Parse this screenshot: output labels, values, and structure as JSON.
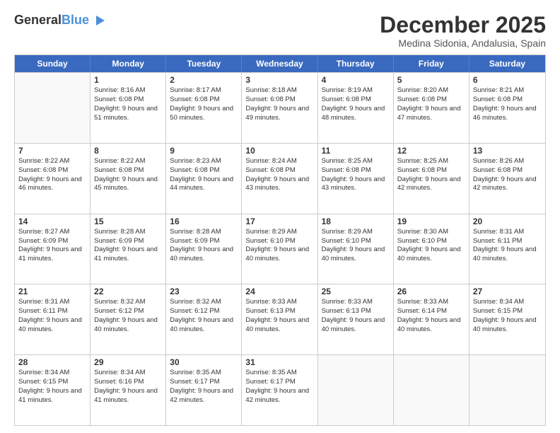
{
  "header": {
    "logo_line1": "General",
    "logo_line2": "Blue",
    "month_title": "December 2025",
    "location": "Medina Sidonia, Andalusia, Spain"
  },
  "days_of_week": [
    "Sunday",
    "Monday",
    "Tuesday",
    "Wednesday",
    "Thursday",
    "Friday",
    "Saturday"
  ],
  "weeks": [
    [
      {
        "day": "",
        "sunrise": "",
        "sunset": "",
        "daylight": ""
      },
      {
        "day": "1",
        "sunrise": "Sunrise: 8:16 AM",
        "sunset": "Sunset: 6:08 PM",
        "daylight": "Daylight: 9 hours and 51 minutes."
      },
      {
        "day": "2",
        "sunrise": "Sunrise: 8:17 AM",
        "sunset": "Sunset: 6:08 PM",
        "daylight": "Daylight: 9 hours and 50 minutes."
      },
      {
        "day": "3",
        "sunrise": "Sunrise: 8:18 AM",
        "sunset": "Sunset: 6:08 PM",
        "daylight": "Daylight: 9 hours and 49 minutes."
      },
      {
        "day": "4",
        "sunrise": "Sunrise: 8:19 AM",
        "sunset": "Sunset: 6:08 PM",
        "daylight": "Daylight: 9 hours and 48 minutes."
      },
      {
        "day": "5",
        "sunrise": "Sunrise: 8:20 AM",
        "sunset": "Sunset: 6:08 PM",
        "daylight": "Daylight: 9 hours and 47 minutes."
      },
      {
        "day": "6",
        "sunrise": "Sunrise: 8:21 AM",
        "sunset": "Sunset: 6:08 PM",
        "daylight": "Daylight: 9 hours and 46 minutes."
      }
    ],
    [
      {
        "day": "7",
        "sunrise": "Sunrise: 8:22 AM",
        "sunset": "Sunset: 6:08 PM",
        "daylight": "Daylight: 9 hours and 46 minutes."
      },
      {
        "day": "8",
        "sunrise": "Sunrise: 8:22 AM",
        "sunset": "Sunset: 6:08 PM",
        "daylight": "Daylight: 9 hours and 45 minutes."
      },
      {
        "day": "9",
        "sunrise": "Sunrise: 8:23 AM",
        "sunset": "Sunset: 6:08 PM",
        "daylight": "Daylight: 9 hours and 44 minutes."
      },
      {
        "day": "10",
        "sunrise": "Sunrise: 8:24 AM",
        "sunset": "Sunset: 6:08 PM",
        "daylight": "Daylight: 9 hours and 43 minutes."
      },
      {
        "day": "11",
        "sunrise": "Sunrise: 8:25 AM",
        "sunset": "Sunset: 6:08 PM",
        "daylight": "Daylight: 9 hours and 43 minutes."
      },
      {
        "day": "12",
        "sunrise": "Sunrise: 8:25 AM",
        "sunset": "Sunset: 6:08 PM",
        "daylight": "Daylight: 9 hours and 42 minutes."
      },
      {
        "day": "13",
        "sunrise": "Sunrise: 8:26 AM",
        "sunset": "Sunset: 6:08 PM",
        "daylight": "Daylight: 9 hours and 42 minutes."
      }
    ],
    [
      {
        "day": "14",
        "sunrise": "Sunrise: 8:27 AM",
        "sunset": "Sunset: 6:09 PM",
        "daylight": "Daylight: 9 hours and 41 minutes."
      },
      {
        "day": "15",
        "sunrise": "Sunrise: 8:28 AM",
        "sunset": "Sunset: 6:09 PM",
        "daylight": "Daylight: 9 hours and 41 minutes."
      },
      {
        "day": "16",
        "sunrise": "Sunrise: 8:28 AM",
        "sunset": "Sunset: 6:09 PM",
        "daylight": "Daylight: 9 hours and 40 minutes."
      },
      {
        "day": "17",
        "sunrise": "Sunrise: 8:29 AM",
        "sunset": "Sunset: 6:10 PM",
        "daylight": "Daylight: 9 hours and 40 minutes."
      },
      {
        "day": "18",
        "sunrise": "Sunrise: 8:29 AM",
        "sunset": "Sunset: 6:10 PM",
        "daylight": "Daylight: 9 hours and 40 minutes."
      },
      {
        "day": "19",
        "sunrise": "Sunrise: 8:30 AM",
        "sunset": "Sunset: 6:10 PM",
        "daylight": "Daylight: 9 hours and 40 minutes."
      },
      {
        "day": "20",
        "sunrise": "Sunrise: 8:31 AM",
        "sunset": "Sunset: 6:11 PM",
        "daylight": "Daylight: 9 hours and 40 minutes."
      }
    ],
    [
      {
        "day": "21",
        "sunrise": "Sunrise: 8:31 AM",
        "sunset": "Sunset: 6:11 PM",
        "daylight": "Daylight: 9 hours and 40 minutes."
      },
      {
        "day": "22",
        "sunrise": "Sunrise: 8:32 AM",
        "sunset": "Sunset: 6:12 PM",
        "daylight": "Daylight: 9 hours and 40 minutes."
      },
      {
        "day": "23",
        "sunrise": "Sunrise: 8:32 AM",
        "sunset": "Sunset: 6:12 PM",
        "daylight": "Daylight: 9 hours and 40 minutes."
      },
      {
        "day": "24",
        "sunrise": "Sunrise: 8:33 AM",
        "sunset": "Sunset: 6:13 PM",
        "daylight": "Daylight: 9 hours and 40 minutes."
      },
      {
        "day": "25",
        "sunrise": "Sunrise: 8:33 AM",
        "sunset": "Sunset: 6:13 PM",
        "daylight": "Daylight: 9 hours and 40 minutes."
      },
      {
        "day": "26",
        "sunrise": "Sunrise: 8:33 AM",
        "sunset": "Sunset: 6:14 PM",
        "daylight": "Daylight: 9 hours and 40 minutes."
      },
      {
        "day": "27",
        "sunrise": "Sunrise: 8:34 AM",
        "sunset": "Sunset: 6:15 PM",
        "daylight": "Daylight: 9 hours and 40 minutes."
      }
    ],
    [
      {
        "day": "28",
        "sunrise": "Sunrise: 8:34 AM",
        "sunset": "Sunset: 6:15 PM",
        "daylight": "Daylight: 9 hours and 41 minutes."
      },
      {
        "day": "29",
        "sunrise": "Sunrise: 8:34 AM",
        "sunset": "Sunset: 6:16 PM",
        "daylight": "Daylight: 9 hours and 41 minutes."
      },
      {
        "day": "30",
        "sunrise": "Sunrise: 8:35 AM",
        "sunset": "Sunset: 6:17 PM",
        "daylight": "Daylight: 9 hours and 42 minutes."
      },
      {
        "day": "31",
        "sunrise": "Sunrise: 8:35 AM",
        "sunset": "Sunset: 6:17 PM",
        "daylight": "Daylight: 9 hours and 42 minutes."
      },
      {
        "day": "",
        "sunrise": "",
        "sunset": "",
        "daylight": ""
      },
      {
        "day": "",
        "sunrise": "",
        "sunset": "",
        "daylight": ""
      },
      {
        "day": "",
        "sunrise": "",
        "sunset": "",
        "daylight": ""
      }
    ]
  ]
}
